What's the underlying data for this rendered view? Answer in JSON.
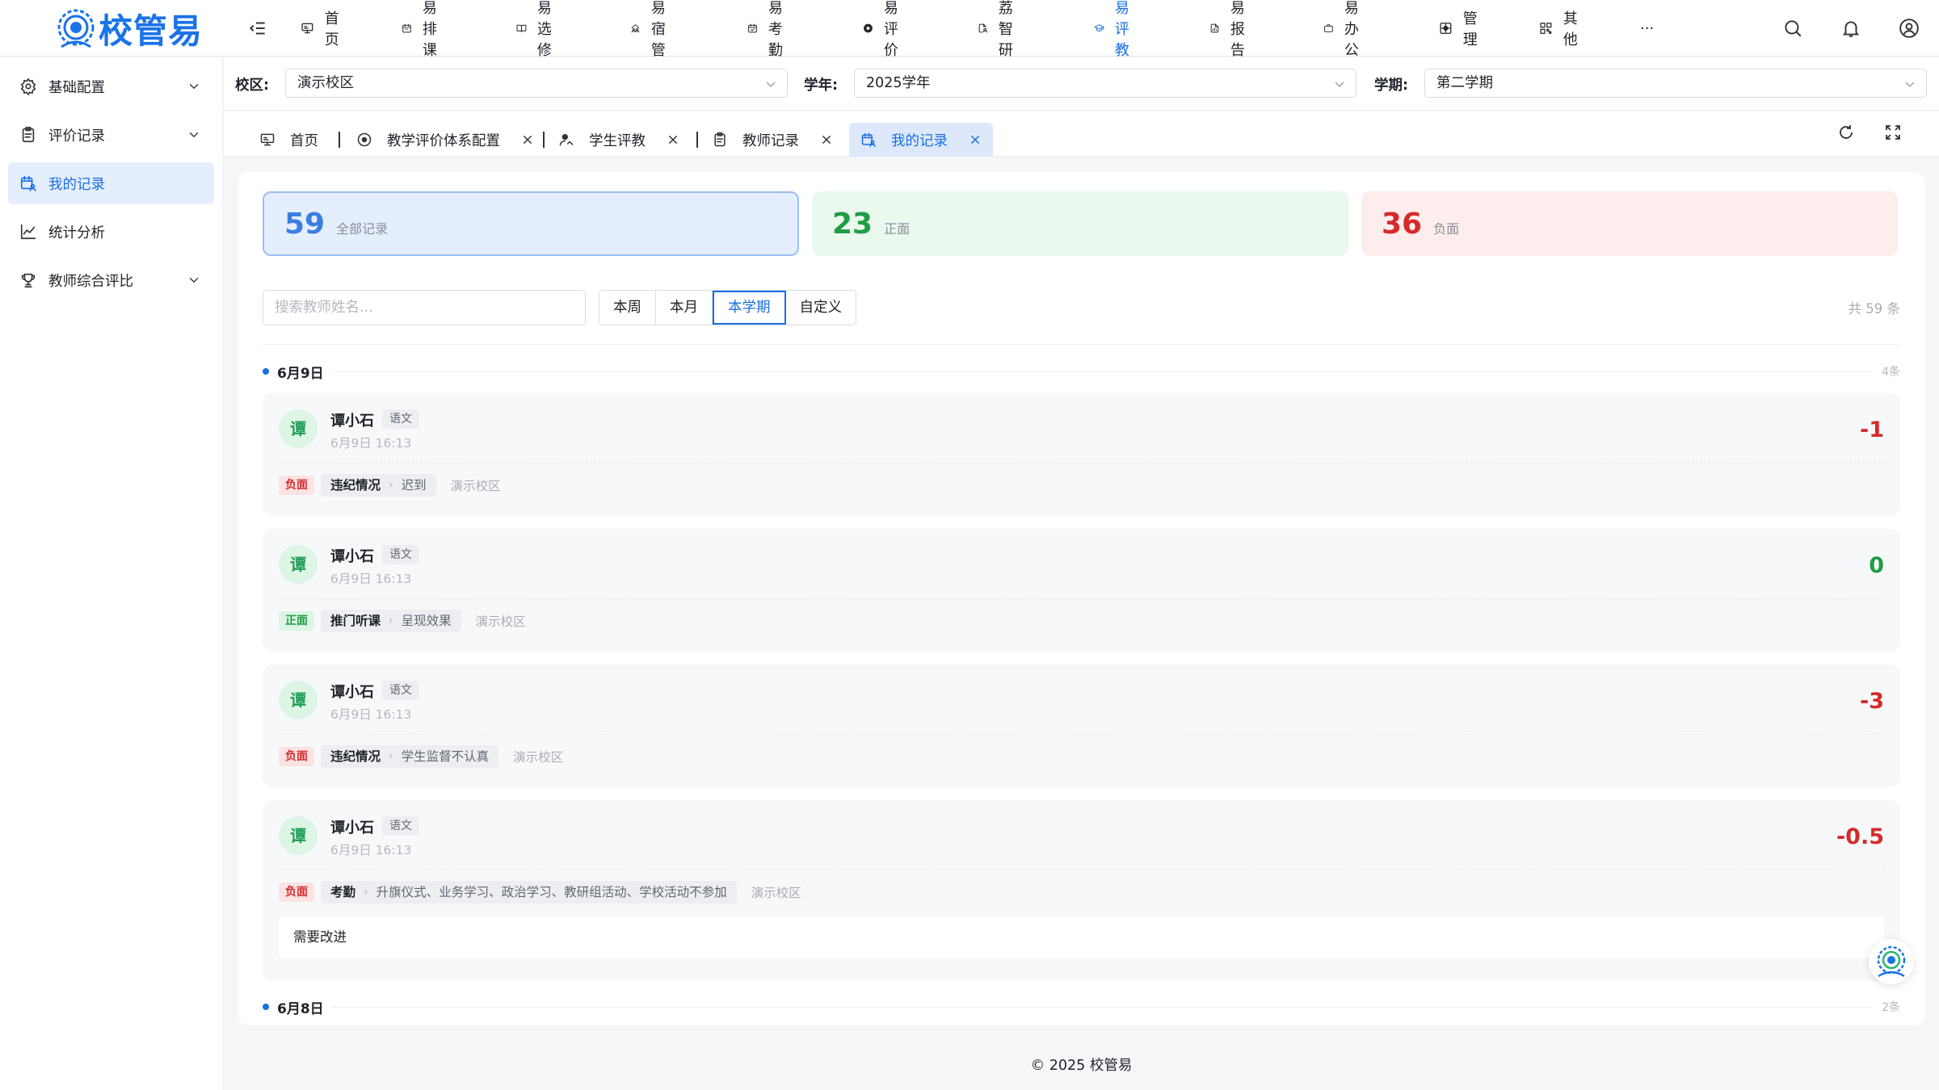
{
  "app": {
    "logo_text": "校管易"
  },
  "nav": {
    "items": [
      {
        "label": "首页",
        "icon": "monitor-icon"
      },
      {
        "label": "易排课",
        "icon": "calendar-icon"
      },
      {
        "label": "易选修",
        "icon": "book-icon"
      },
      {
        "label": "易宿管",
        "icon": "home-people-icon"
      },
      {
        "label": "易考勤",
        "icon": "calendar-check-icon"
      },
      {
        "label": "易评价",
        "icon": "star-circle-icon"
      },
      {
        "label": "荔智研",
        "icon": "file-user-icon"
      },
      {
        "label": "易评教",
        "icon": "graduation-cap-icon",
        "active": true
      },
      {
        "label": "易报告",
        "icon": "report-icon"
      },
      {
        "label": "易办公",
        "icon": "briefcase-icon"
      },
      {
        "label": "管理",
        "icon": "settings-box-icon"
      },
      {
        "label": "其他",
        "icon": "grid-icon"
      },
      {
        "label": "···",
        "icon": ""
      }
    ]
  },
  "sidebar": {
    "items": [
      {
        "label": "基础配置",
        "icon": "gear-icon",
        "has_children": true
      },
      {
        "label": "评价记录",
        "icon": "clipboard-icon",
        "has_children": true
      },
      {
        "label": "我的记录",
        "icon": "calendar-user-icon",
        "active": true
      },
      {
        "label": "统计分析",
        "icon": "line-chart-icon"
      },
      {
        "label": "教师综合评比",
        "icon": "trophy-icon",
        "has_children": true
      }
    ]
  },
  "filters": {
    "campus_label": "校区:",
    "campus_value": "演示校区",
    "year_label": "学年:",
    "year_value": "2025学年",
    "term_label": "学期:",
    "term_value": "第二学期"
  },
  "tabs": [
    {
      "label": "首页",
      "icon": "monitor-icon",
      "closable": false
    },
    {
      "label": "教学评价体系配置",
      "icon": "target-icon",
      "closable": true
    },
    {
      "label": "学生评教",
      "icon": "student-icon",
      "closable": true
    },
    {
      "label": "教师记录",
      "icon": "clipboard-icon",
      "closable": true
    },
    {
      "label": "我的记录",
      "icon": "calendar-user-icon",
      "closable": true,
      "active": true
    }
  ],
  "stats": [
    {
      "value": "59",
      "label": "全部记录",
      "color": "#3b7ee0"
    },
    {
      "value": "23",
      "label": "正面",
      "color": "#1f9d45"
    },
    {
      "value": "36",
      "label": "负面",
      "color": "#d42b2b"
    }
  ],
  "search": {
    "placeholder": "搜索教师姓名..."
  },
  "ranges": [
    {
      "label": "本周"
    },
    {
      "label": "本月"
    },
    {
      "label": "本学期",
      "active": true
    },
    {
      "label": "自定义"
    }
  ],
  "total": "共 59 条",
  "groups": [
    {
      "date": "6月9日",
      "count": "4条",
      "records": [
        {
          "avatar": "谭",
          "name": "谭小石",
          "subject": "语文",
          "time": "6月9日 16:13",
          "score": "-1",
          "polarity": "负面",
          "category": "违纪情况",
          "item": "迟到",
          "campus": "演示校区"
        },
        {
          "avatar": "谭",
          "name": "谭小石",
          "subject": "语文",
          "time": "6月9日 16:13",
          "score": "0",
          "polarity": "正面",
          "category": "推门听课",
          "item": "呈现效果",
          "campus": "演示校区"
        },
        {
          "avatar": "谭",
          "name": "谭小石",
          "subject": "语文",
          "time": "6月9日 16:13",
          "score": "-3",
          "polarity": "负面",
          "category": "违纪情况",
          "item": "学生监督不认真",
          "campus": "演示校区"
        },
        {
          "avatar": "谭",
          "name": "谭小石",
          "subject": "语文",
          "time": "6月9日 16:13",
          "score": "-0.5",
          "polarity": "负面",
          "category": "考勤",
          "item": "升旗仪式、业务学习、政治学习、教研组活动、学校活动不参加",
          "campus": "演示校区",
          "note": "需要改进"
        }
      ]
    },
    {
      "date": "6月8日",
      "count": "2条",
      "records": []
    }
  ],
  "colors": {
    "accent": "#1a6fe0",
    "positive": "#1f9d45",
    "negative": "#d42b2b"
  },
  "footer": "© 2025 校管易"
}
